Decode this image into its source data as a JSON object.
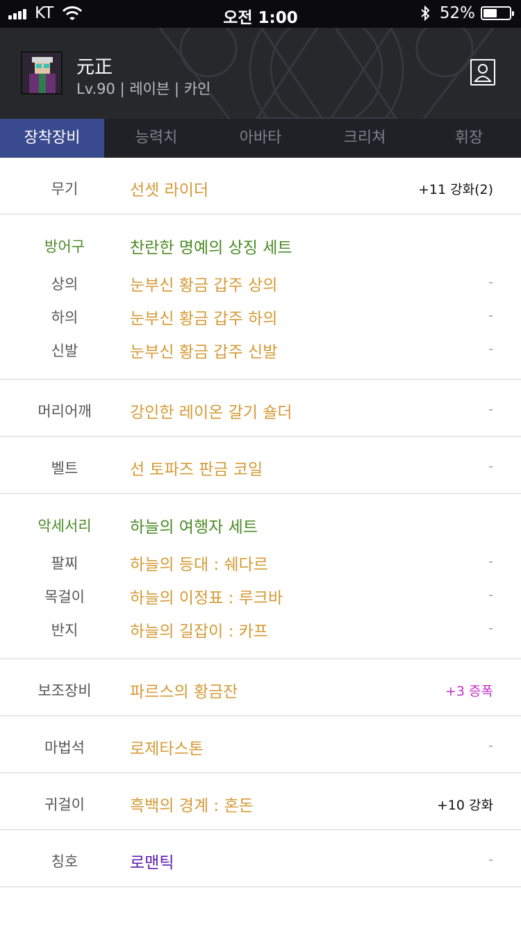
{
  "status_bar": {
    "carrier": "KT",
    "time": "오전 1:00",
    "battery_pct": "52%",
    "battery_fraction": 0.52
  },
  "character": {
    "name": "元正",
    "info": "Lv.90 | 레이븐 | 카인"
  },
  "tabs": [
    {
      "label": "장착장비",
      "active": true
    },
    {
      "label": "능력치",
      "active": false
    },
    {
      "label": "아바타",
      "active": false
    },
    {
      "label": "크리쳐",
      "active": false
    },
    {
      "label": "휘장",
      "active": false
    }
  ],
  "equipment": {
    "weapon": {
      "slot": "무기",
      "item": "선셋 라이더",
      "extra": "+11 강화(2)"
    },
    "armor": {
      "set_slot": "방어구",
      "set_name": "찬란한 명예의 상징 세트",
      "rows": [
        {
          "slot": "상의",
          "item": "눈부신 황금 갑주 상의",
          "extra": "-"
        },
        {
          "slot": "하의",
          "item": "눈부신 황금 갑주 하의",
          "extra": "-"
        },
        {
          "slot": "신발",
          "item": "눈부신 황금 갑주 신발",
          "extra": "-"
        }
      ]
    },
    "shoulder": {
      "slot": "머리어깨",
      "item": "강인한 레이온 갈기 숄더",
      "extra": "-"
    },
    "belt": {
      "slot": "벨트",
      "item": "선 토파즈 판금 코일",
      "extra": "-"
    },
    "accessory": {
      "set_slot": "악세서리",
      "set_name": "하늘의 여행자 세트",
      "rows": [
        {
          "slot": "팔찌",
          "item": "하늘의 등대 : 쉐다르",
          "extra": "-"
        },
        {
          "slot": "목걸이",
          "item": "하늘의 이정표 : 루크바",
          "extra": "-"
        },
        {
          "slot": "반지",
          "item": "하늘의 길잡이 : 카프",
          "extra": "-"
        }
      ]
    },
    "sub": {
      "slot": "보조장비",
      "item": "파르스의 황금잔",
      "extra": "+3 증폭"
    },
    "magic_stone": {
      "slot": "마법석",
      "item": "로제타스톤",
      "extra": "-"
    },
    "earring": {
      "slot": "귀걸이",
      "item": "흑백의 경계 : 혼돈",
      "extra": "+10 강화"
    },
    "title": {
      "slot": "칭호",
      "item": "로맨틱",
      "extra": "-"
    }
  },
  "colors": {
    "item_gold": "#d49a35",
    "set_green": "#4a8a24",
    "title_violet": "#5a1ab0",
    "amplify_purple": "#c22fc7",
    "active_tab": "#3a4a8e"
  },
  "icons": [
    "signal-icon",
    "wifi-icon",
    "bluetooth-icon",
    "battery-icon",
    "profile-card-icon"
  ]
}
